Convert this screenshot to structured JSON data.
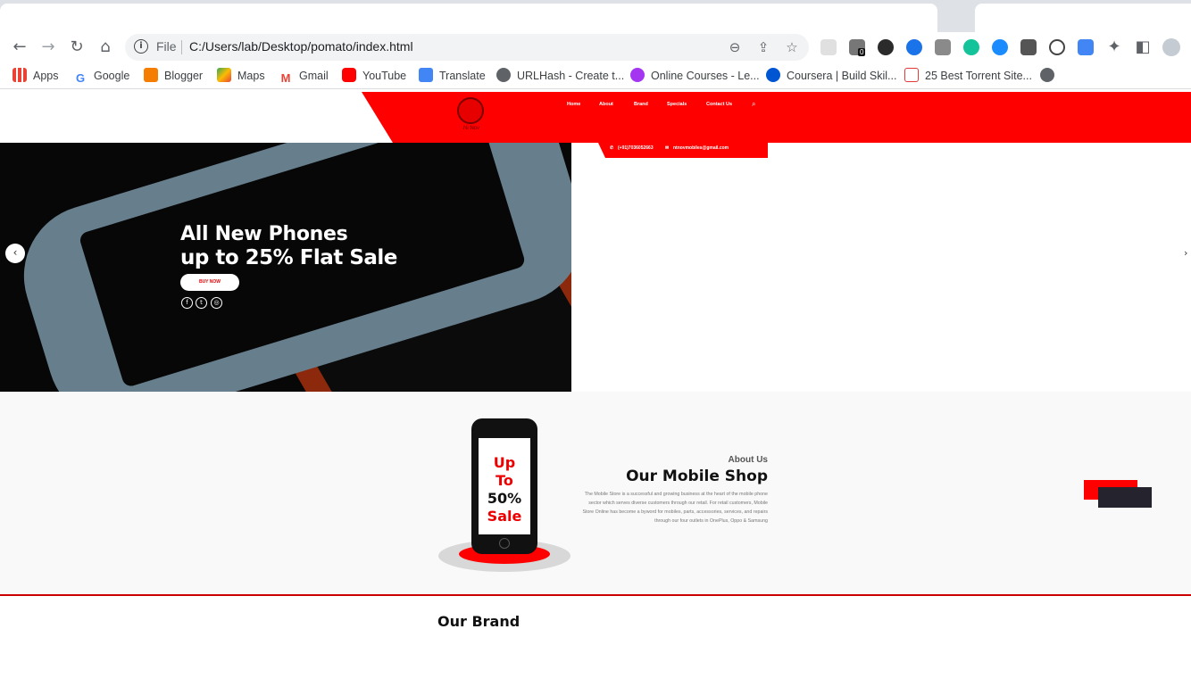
{
  "browser": {
    "url_scheme": "File",
    "url": "C:/Users/lab/Desktop/pomato/index.html",
    "extension_badge": "0"
  },
  "bookmarks": [
    {
      "label": "Apps",
      "icon": "apps-grid-icon"
    },
    {
      "label": "Google",
      "icon": "google-icon"
    },
    {
      "label": "Blogger",
      "icon": "blogger-icon"
    },
    {
      "label": "Maps",
      "icon": "maps-icon"
    },
    {
      "label": "Gmail",
      "icon": "gmail-icon"
    },
    {
      "label": "YouTube",
      "icon": "youtube-icon"
    },
    {
      "label": "Translate",
      "icon": "translate-icon"
    },
    {
      "label": "URLHash - Create t...",
      "icon": "globe-icon"
    },
    {
      "label": "Online Courses - Le...",
      "icon": "udemy-icon"
    },
    {
      "label": "Coursera | Build Skil...",
      "icon": "coursera-icon"
    },
    {
      "label": "25 Best Torrent Site...",
      "icon": "torrent-icon"
    }
  ],
  "site": {
    "logo_text": "Ni Nov",
    "nav": [
      "Home",
      "About",
      "Brand",
      "Specials",
      "Contact Us"
    ],
    "phone": "(+91)7036052663",
    "email": "ntnovmobiles@gmail.com"
  },
  "hero": {
    "line1": "All New Phones",
    "line2": "up to 25% Flat Sale",
    "button": "BUY NOW"
  },
  "about": {
    "sale_lines": [
      "Up",
      "To",
      "50%",
      "Sale"
    ],
    "subtitle": "About Us",
    "title": "Our Mobile Shop",
    "description": "The Mobile Store is a successful and growing business at the heart of the mobile phone sector which serves diverse customers through our retail. For retail customers, Mobile Store Online has become a byword for mobiles, parts, accessories, services, and repairs through our four outlets in OnePlus, Oppo & Samsung"
  },
  "brand": {
    "title": "Our Brand"
  },
  "colors": {
    "accent": "#ff0000",
    "dark": "#25232d"
  }
}
